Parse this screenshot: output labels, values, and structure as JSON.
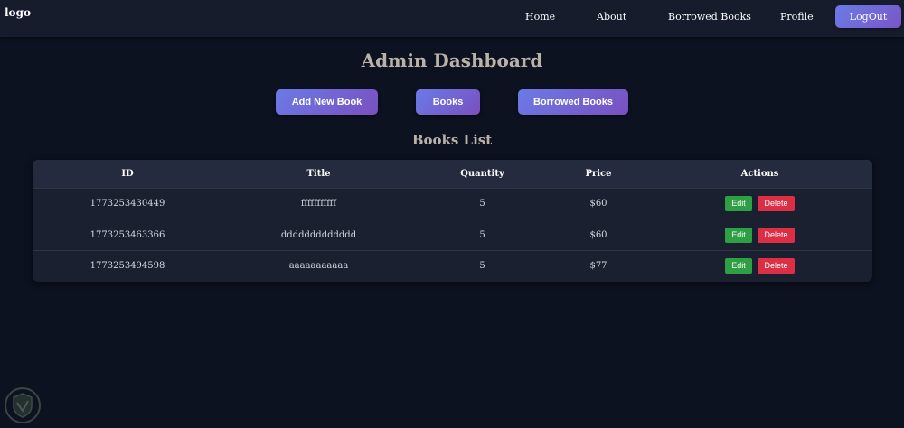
{
  "navbar": {
    "logo": "logo",
    "links": [
      {
        "label": "Home"
      },
      {
        "label": "About"
      },
      {
        "label": "Borrowed Books"
      },
      {
        "label": "Profile"
      }
    ],
    "logout_label": "LogOut"
  },
  "page": {
    "title": "Admin Dashboard",
    "actions": [
      {
        "label": "Add New Book"
      },
      {
        "label": "Books"
      },
      {
        "label": "Borrowed Books"
      }
    ],
    "section_title": "Books List"
  },
  "table": {
    "columns": [
      "ID",
      "Title",
      "Quantity",
      "Price",
      "Actions"
    ],
    "rows": [
      {
        "id": "1773253430449",
        "title": "fffffffffff",
        "quantity": "5",
        "price": "$60"
      },
      {
        "id": "1773253463366",
        "title": "ddddddddddddd",
        "quantity": "5",
        "price": "$60"
      },
      {
        "id": "1773253494598",
        "title": "aaaaaaaaaaa",
        "quantity": "5",
        "price": "$77"
      }
    ],
    "edit_label": "Edit",
    "delete_label": "Delete"
  },
  "colors": {
    "background": "#0d1220",
    "navbar": "#161c2b",
    "accent_gradient_start": "#6a7be6",
    "accent_gradient_end": "#7a4fc0",
    "edit": "#2ea043",
    "delete": "#dc2f45"
  }
}
